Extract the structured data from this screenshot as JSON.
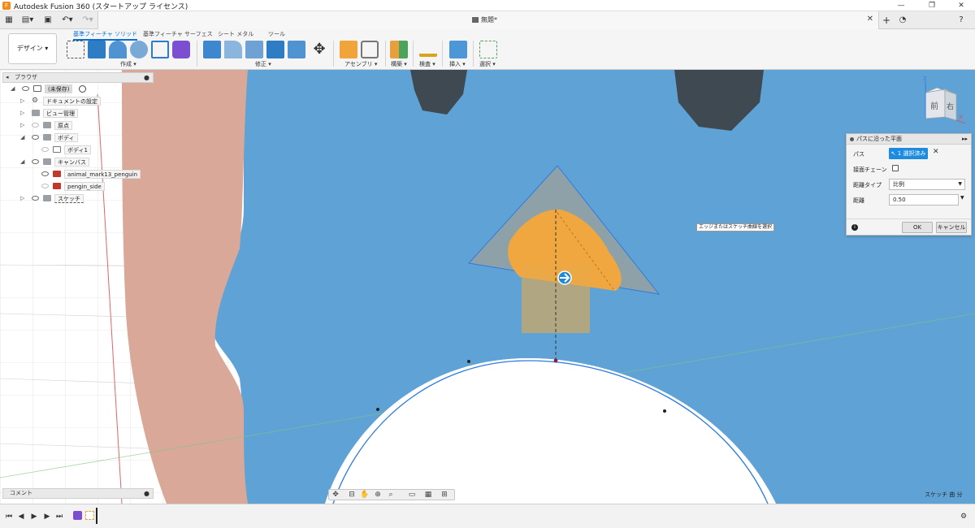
{
  "window": {
    "title": "Autodesk Fusion 360 (スタートアップ ライセンス)",
    "minimize": "—",
    "restore": "❐",
    "close": "✕"
  },
  "tabbar": {
    "document_name": "無題*",
    "close": "✕",
    "new_tab": "+"
  },
  "ribbon": {
    "workspace": "デザイン ▾",
    "tabs": [
      "基準フィーチャ ソリッド",
      "基準フィーチャ サーフェス",
      "シート メタル",
      "ツール"
    ],
    "active_tab": 0,
    "groups": [
      "作成 ▾",
      "修正 ▾",
      "アセンブリ ▾",
      "構築 ▾",
      "検査 ▾",
      "挿入 ▾",
      "選択 ▾"
    ]
  },
  "browser": {
    "header": "ブラウザ",
    "items": [
      {
        "label": "(未保存)",
        "level": 0
      },
      {
        "label": "ドキュメントの設定",
        "level": 1
      },
      {
        "label": "ビュー管理",
        "level": 1
      },
      {
        "label": "原点",
        "level": 1
      },
      {
        "label": "ボディ",
        "level": 1
      },
      {
        "label": "ボディ1",
        "level": 2
      },
      {
        "label": "キャンバス",
        "level": 1
      },
      {
        "label": "animal_mark13_penguin",
        "level": 2
      },
      {
        "label": "pengin_side",
        "level": 2
      },
      {
        "label": "スケッチ",
        "level": 1
      }
    ]
  },
  "comments": {
    "label": "コメント"
  },
  "viewcube": {
    "front": "前",
    "right": "右",
    "axis_z": "Z",
    "axis_x": "X"
  },
  "dialog": {
    "title": "パスに沿った平面",
    "path_label": "パス",
    "path_value": "1 選択済み",
    "chain_label": "接面チェーン",
    "distance_type_label": "距離タイプ",
    "distance_type_value": "比例",
    "distance_label": "距離",
    "distance_value": "0.50",
    "ok": "OK",
    "cancel": "キャンセル"
  },
  "tooltip": {
    "text": "エッジまたはスケッチ曲線を選択"
  },
  "status": {
    "sketch": "スケッチ 曲 分"
  },
  "colors": {
    "ribbon_active": "#0b6fd0",
    "canvas_blue": "#5fa3d6",
    "canvas_pink": "#d9a898",
    "plane_orange": "#f7a83a",
    "selection_blue": "#1d8ce0"
  }
}
